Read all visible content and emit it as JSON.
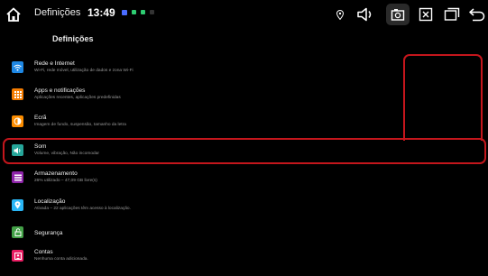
{
  "statusbar": {
    "title": "Definições",
    "time": "13:49"
  },
  "page": {
    "title": "Definições"
  },
  "settings": [
    {
      "label": "Rede e Internet",
      "sub": "Wi-Fi, rede móvel, utilização de dados e zona Wi-Fi",
      "icon": "wifi-icon",
      "color": "#1e88e5"
    },
    {
      "label": "Apps e notificações",
      "sub": "Aplicações recentes, aplicações predefinidas",
      "icon": "apps-icon",
      "color": "#f57c00"
    },
    {
      "label": "Ecrã",
      "sub": "Imagem de fundo, suspensão, tamanho da letra",
      "icon": "display-icon",
      "color": "#fb8c00"
    },
    {
      "label": "Som",
      "sub": "Volume, vibração, Não incomodar",
      "icon": "volume-icon",
      "color": "#26a69a"
    },
    {
      "label": "Armazenamento",
      "sub": "26% utilizado – 47,09 GB livre(s)",
      "icon": "storage-icon",
      "color": "#8e24aa"
    },
    {
      "label": "Localização",
      "sub": "Ativada – 22 aplicações têm acesso à localização.",
      "icon": "location-icon",
      "color": "#29b6f6"
    },
    {
      "label": "Segurança",
      "sub": "",
      "icon": "lock-icon",
      "color": "#43a047"
    },
    {
      "label": "Contas",
      "sub": "Nenhuma conta adicionada.",
      "icon": "account-icon",
      "color": "#e91e63"
    }
  ],
  "colors": {
    "highlight": "#c4161c",
    "background": "#000000"
  }
}
